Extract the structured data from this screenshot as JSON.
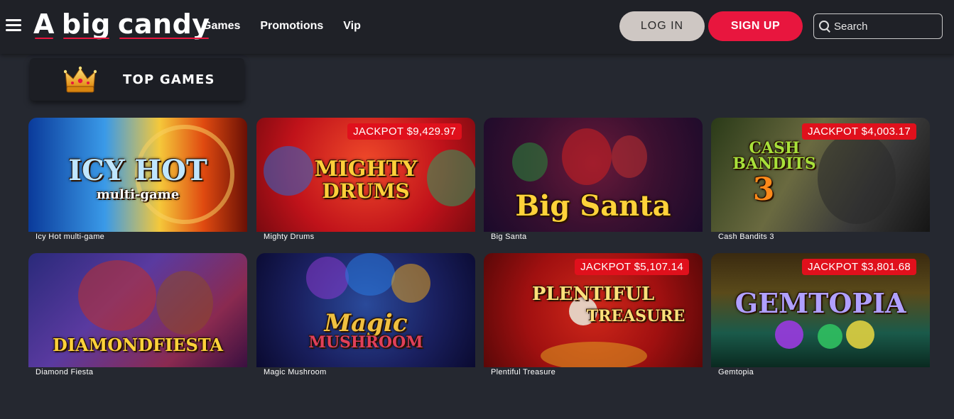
{
  "header": {
    "logo_word1": "A",
    "logo_word2": "big",
    "logo_word3": "candy",
    "nav": [
      "Games",
      "Promotions",
      "Vip"
    ],
    "login_label": "LOG IN",
    "signup_label": "SIGN UP",
    "search_placeholder": "Search",
    "search_value": ""
  },
  "section": {
    "title": "TOP GAMES",
    "icon": "crown-icon"
  },
  "colors": {
    "accent": "#e8163e",
    "jackpot": "#e0101c",
    "background": "#252830",
    "header": "#1f2127"
  },
  "games": [
    {
      "name": "Icy Hot multi-game",
      "art_title": "ICY HOT",
      "art_subtitle": "multi-game",
      "jackpot": ""
    },
    {
      "name": "Mighty Drums",
      "art_title": "MIGHTY",
      "art_subtitle": "DRUMS",
      "jackpot": "JACKPOT $9,429.97"
    },
    {
      "name": "Big Santa",
      "art_title": "Big Santa",
      "art_subtitle": "",
      "jackpot": ""
    },
    {
      "name": "Cash Bandits 3",
      "art_title": "CASH BANDITS",
      "art_subtitle": "3",
      "jackpot": "JACKPOT $4,003.17"
    },
    {
      "name": "Diamond Fiesta",
      "art_title": "DIAMONDFIESTA",
      "art_subtitle": "",
      "jackpot": ""
    },
    {
      "name": "Magic Mushroom",
      "art_title": "Magic",
      "art_subtitle": "MUSHROOM",
      "jackpot": ""
    },
    {
      "name": "Plentiful Treasure",
      "art_title": "PLENTIFUL",
      "art_subtitle": "TREASURE",
      "jackpot": "JACKPOT $5,107.14"
    },
    {
      "name": "Gemtopia",
      "art_title": "GEMTOPIA",
      "art_subtitle": "",
      "jackpot": "JACKPOT $3,801.68"
    }
  ]
}
